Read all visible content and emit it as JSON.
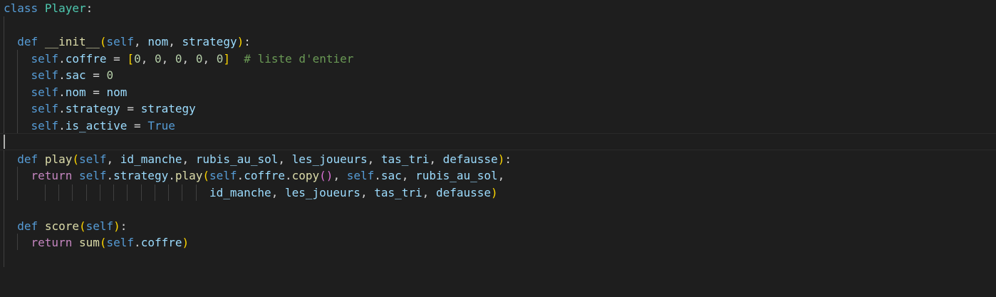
{
  "editor": {
    "language": "python",
    "lines": [
      "class Player:",
      "",
      "  def __init__(self, nom, strategy):",
      "    self.coffre = [0, 0, 0, 0, 0]  # liste d'entier",
      "    self.sac = 0",
      "    self.nom = nom",
      "    self.strategy = strategy",
      "    self.is_active = True",
      "",
      "  def play(self, id_manche, rubis_au_sol, les_joueurs, tas_tri, defausse):",
      "    return self.strategy.play(self.coffre.copy(), self.sac, rubis_au_sol,",
      "                              id_manche, les_joueurs, tas_tri, defausse)",
      "",
      "  def score(self):",
      "    return sum(self.coffre)"
    ],
    "colors": {
      "background": "#1e1e1e",
      "keyword": "#569cd6",
      "control_keyword": "#c586c0",
      "class_name": "#4ec9b0",
      "function": "#dcdcaa",
      "variable": "#9cdcfe",
      "number": "#b5cea8",
      "comment": "#6a9955",
      "bracket_level_1": "#ffd700",
      "bracket_level_2": "#da70d6",
      "bracket_level_3": "#179fff"
    }
  }
}
